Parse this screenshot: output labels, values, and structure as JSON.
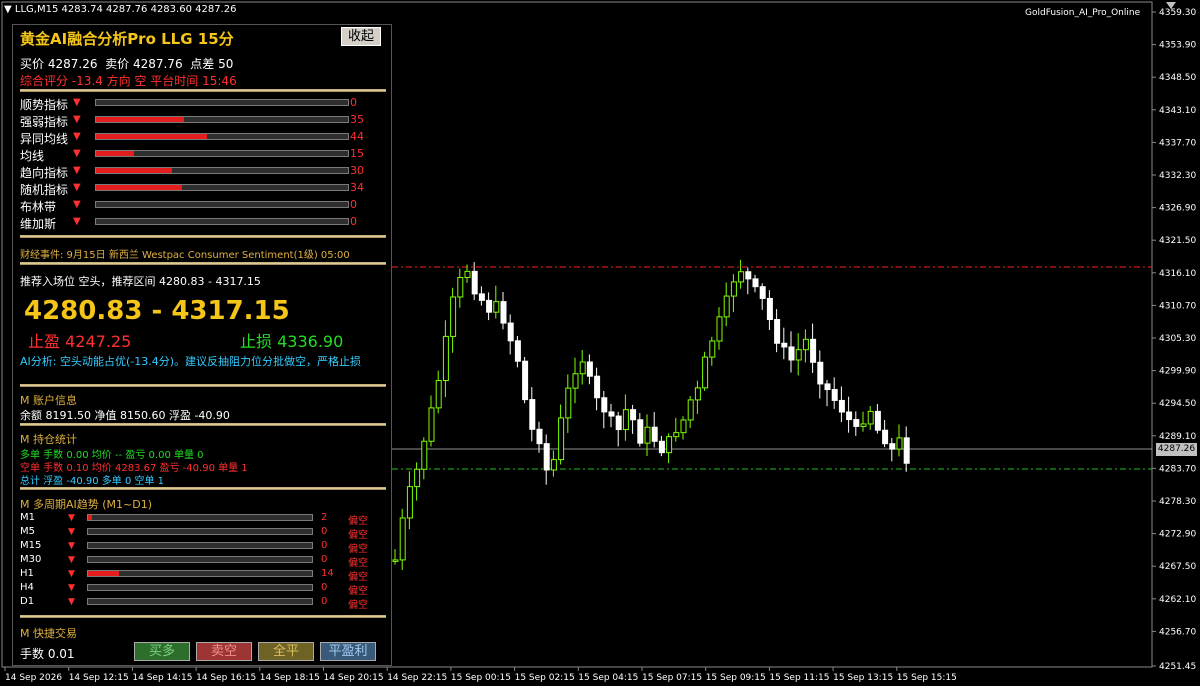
{
  "chart_header": {
    "symbol": "LLG,M15",
    "ohlc": "4283.74 4287.76 4283.60 4287.26"
  },
  "ea_name": "GoldFusion_AI_Pro_Online",
  "current_price_label": "4287.26",
  "y_axis_labels": [
    "4359.30",
    "4353.90",
    "4348.50",
    "4343.10",
    "4337.70",
    "4332.30",
    "4326.90",
    "4321.50",
    "4316.10",
    "4310.70",
    "4305.30",
    "4299.90",
    "4294.50",
    "4289.10",
    "4283.70",
    "4278.30",
    "4272.90",
    "4267.50",
    "4262.10",
    "4256.70",
    "4251.45"
  ],
  "x_axis_labels": [
    "14 Sep 2026",
    "14 Sep 12:15",
    "14 Sep 14:15",
    "14 Sep 16:15",
    "14 Sep 18:15",
    "14 Sep 20:15",
    "14 Sep 22:15",
    "15 Sep 00:15",
    "15 Sep 02:15",
    "15 Sep 04:15",
    "15 Sep 07:15",
    "15 Sep 09:15",
    "15 Sep 11:15",
    "15 Sep 13:15",
    "15 Sep 15:15"
  ],
  "colors": {
    "bull": "#7fff00",
    "bear": "#ffffff",
    "resistance": "#ff2020",
    "support": "#20c020",
    "grid_price": "#c0c0c0"
  },
  "panel": {
    "title": "黄金AI融合分析Pro  LLG 15分",
    "collapse": "收起",
    "quote": {
      "bid_label": "买价",
      "bid": "4287.26",
      "ask_label": "卖价",
      "ask": "4287.76",
      "spread_label": "点差",
      "spread": "50"
    },
    "score_line": "综合评分 -13.4  方向 空  平台时间 15:46",
    "indicators": [
      {
        "name": "顺势指标",
        "value": 0
      },
      {
        "name": "强弱指标",
        "value": 35
      },
      {
        "name": "异同均线",
        "value": 44
      },
      {
        "name": "均线",
        "value": 15
      },
      {
        "name": "趋向指标",
        "value": 30
      },
      {
        "name": "随机指标",
        "value": 34
      },
      {
        "name": "布林带",
        "value": 0
      },
      {
        "name": "维加斯",
        "value": 0
      }
    ],
    "arrow": "▼",
    "event": "财经事件: 9月15日 新西兰 Westpac Consumer Sentiment(1级) 05:00",
    "entry_line": "推荐入场位 空头，推荐区间 4280.83 - 4317.15",
    "range": "4280.83 - 4317.15",
    "tp_label": "止盈",
    "tp": "4247.25",
    "sl_label": "止损",
    "sl": "4336.90",
    "ai_note": "AI分析: 空头动能占优(-13.4分)。建议反抽阻力位分批做空，严格止损",
    "account": {
      "header": "M 账户信息",
      "line": "余额 8191.50  净值 8150.60  浮盈 -40.90"
    },
    "positions": {
      "header": "M 持仓统计",
      "long": "多单  手数 0.00  均价 --  盈亏 0.00  单量 0",
      "short": "空单  手数 0.10  均价 4283.67  盈亏 -40.90  单量 1",
      "total": "总计  浮盈 -40.90  多单 0  空单 1"
    },
    "timeframes": {
      "header": "M 多周期AI趋势  (M1~D1)",
      "rows": [
        {
          "tf": "M1",
          "value": 2,
          "trend": "偏空"
        },
        {
          "tf": "M5",
          "value": 0,
          "trend": "偏空"
        },
        {
          "tf": "M15",
          "value": 0,
          "trend": "偏空"
        },
        {
          "tf": "M30",
          "value": 0,
          "trend": "偏空"
        },
        {
          "tf": "H1",
          "value": 14,
          "trend": "偏空"
        },
        {
          "tf": "H4",
          "value": 0,
          "trend": "偏空"
        },
        {
          "tf": "D1",
          "value": 0,
          "trend": "偏空"
        }
      ]
    },
    "trade": {
      "header": "M 快捷交易",
      "lots": "手数 0.01",
      "buy": "买多",
      "sell": "卖空",
      "close_all": "全平",
      "close_profit": "平盈利"
    }
  }
}
